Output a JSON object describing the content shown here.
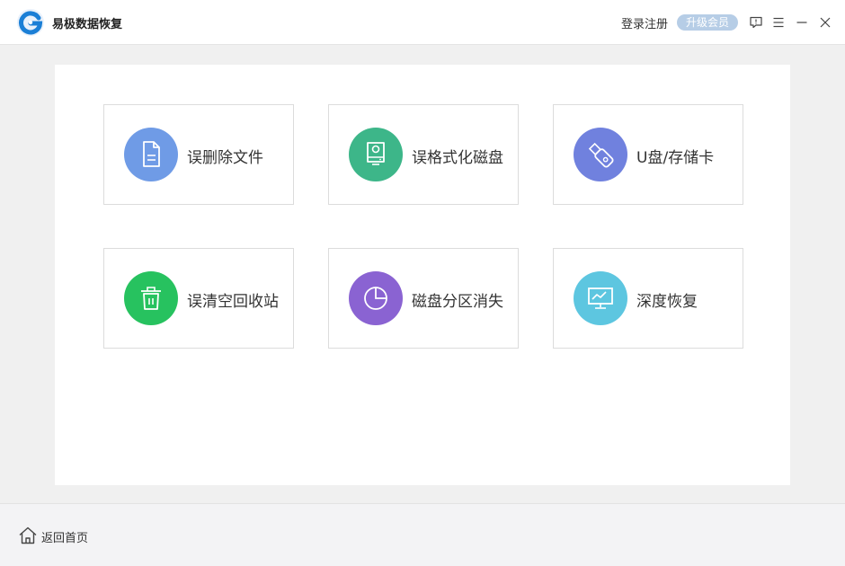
{
  "header": {
    "app_title": "易极数据恢复",
    "login_label": "登录注册",
    "vip_label": "升级会员",
    "logo_icon": "app-logo-icon",
    "controls": [
      "feedback-icon",
      "menu-icon",
      "minimize-icon",
      "close-icon"
    ]
  },
  "cards": [
    {
      "label": "误删除文件",
      "icon": "document-icon",
      "color": "#6f9be6"
    },
    {
      "label": "误格式化磁盘",
      "icon": "hard-disk-icon",
      "color": "#3db689"
    },
    {
      "label": "U盘/存储卡",
      "icon": "usb-drive-icon",
      "color": "#7081de"
    },
    {
      "label": "误清空回收站",
      "icon": "trash-icon",
      "color": "#27c25f"
    },
    {
      "label": "磁盘分区消失",
      "icon": "pie-chart-icon",
      "color": "#8a63d2"
    },
    {
      "label": "深度恢复",
      "icon": "monitor-chart-icon",
      "color": "#5dc6e0"
    }
  ],
  "footer": {
    "home_label": "返回首页",
    "home_icon": "home-icon"
  },
  "colors": {
    "accent": "#1b7fd6",
    "vip_badge": "#b6cde6",
    "background": "#f0f0f0"
  }
}
